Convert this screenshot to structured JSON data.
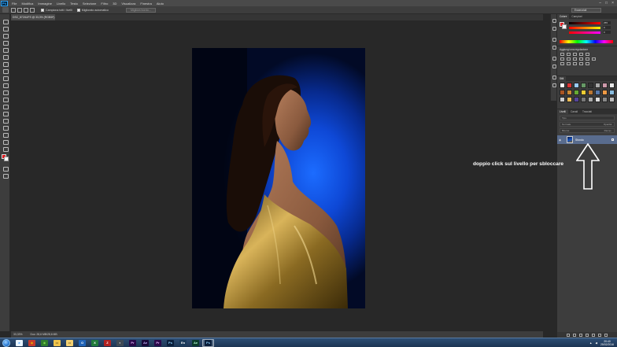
{
  "menubar": {
    "logo": "Ps",
    "items": [
      "File",
      "Modifica",
      "Immagine",
      "Livello",
      "Testo",
      "Selezione",
      "Filtro",
      "3D",
      "Visualizza",
      "Finestra",
      "Aiuto"
    ],
    "window_controls": [
      "–",
      "□",
      "×"
    ]
  },
  "options": {
    "sample_all_layers": "Campiona tutti i livelli",
    "auto_enhance": "Migliorato automatico",
    "refine_edge": "Migliora bordo...",
    "workspace": "Essenziali"
  },
  "document": {
    "tab_title": "DSC_8724LIFS @ 33,3% (RGB/8*)",
    "zoom": "33,33%",
    "doc_size": "Doc: 28,6 MB/28,6 MB"
  },
  "panels": {
    "color_tabs": [
      "Colore",
      "Campioni"
    ],
    "color_values": {
      "r": "255",
      "g": "0",
      "b": "0"
    },
    "adjust_title": "Aggiungi una regolazione",
    "styles_title": "Stili",
    "layers_tabs": [
      "Livelli",
      "Canali",
      "Tracciati"
    ],
    "layers_kind": "Tipo",
    "layers_mode": "Normale",
    "opacity_label": "Opacità:",
    "fill_label": "Riemp.:",
    "lock_label": "Blocca:",
    "layer_name": "Sfondo"
  },
  "annotation": {
    "text": "doppio click sul livello per sbloccare"
  },
  "taskbar": {
    "apps": [
      {
        "icon": "ie-icon",
        "label": "e",
        "color": "#1e90ff",
        "bg": "#e9f4ff"
      },
      {
        "icon": "chrome-icon",
        "label": "◉",
        "color": "#e8b100",
        "bg": "#c43b2c"
      },
      {
        "icon": "chrome-canary-icon",
        "label": "◉",
        "color": "#7bd64a",
        "bg": "#2f7d2c"
      },
      {
        "icon": "explorer-icon",
        "label": "▭",
        "color": "#3a2a0a",
        "bg": "#f0c44c"
      },
      {
        "icon": "folder-icon",
        "label": "▭",
        "color": "#3a2a0a",
        "bg": "#f3d070"
      },
      {
        "icon": "outlook-icon",
        "label": "O",
        "color": "#ffffff",
        "bg": "#1f63b8"
      },
      {
        "icon": "excel-icon",
        "label": "X",
        "color": "#ffffff",
        "bg": "#1f7a3a"
      },
      {
        "icon": "filezilla-icon",
        "label": "Z",
        "color": "#ffffff",
        "bg": "#b22222"
      },
      {
        "icon": "app-icon",
        "label": "◐",
        "color": "#ffffff",
        "bg": "#3f4a55"
      },
      {
        "icon": "premiere-icon",
        "label": "Pr",
        "color": "#e6b3ff",
        "bg": "#2a0a4a"
      },
      {
        "icon": "after-effects-icon",
        "label": "Ae",
        "color": "#c6b3ff",
        "bg": "#1a0a3a"
      },
      {
        "icon": "premiere-icon-2",
        "label": "Pr",
        "color": "#e6b3ff",
        "bg": "#2a0a4a"
      },
      {
        "icon": "photoshop-icon-2",
        "label": "Ps",
        "color": "#8fd2ff",
        "bg": "#0a1e3a"
      },
      {
        "icon": "encore-icon",
        "label": "En",
        "color": "#ffffff",
        "bg": "#1a3a5a"
      },
      {
        "icon": "media-encoder-icon",
        "label": "Ae",
        "color": "#b3ffd1",
        "bg": "#0a3a2a"
      },
      {
        "icon": "photoshop-icon-active",
        "label": "Ps",
        "color": "#8fd2ff",
        "bg": "#0a1e3a",
        "active": true
      }
    ],
    "time": "20:40",
    "date": "25/02/2016"
  }
}
